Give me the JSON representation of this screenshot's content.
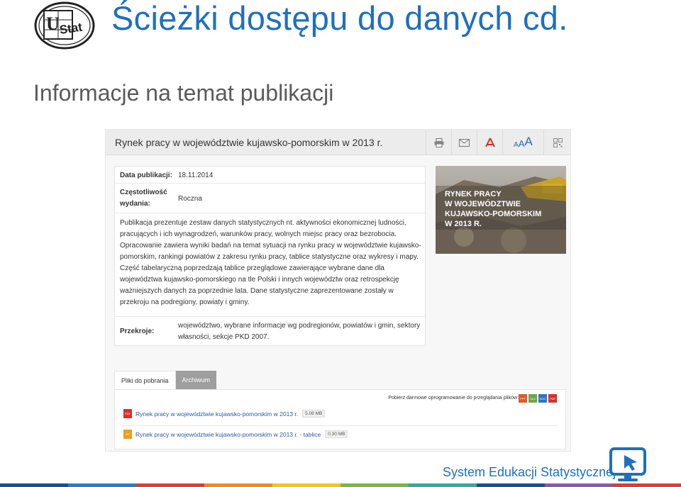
{
  "slide": {
    "title": "Ścieżki dostępu do danych cd.",
    "subtitle": "Informacje na temat publikacji",
    "footer": "System Edukacji Statystycznej",
    "logo_text": "UStat",
    "bar_colors": [
      "#1a4f8f",
      "#2e7bc4",
      "#e03a3a",
      "#f08a24",
      "#f4c518",
      "#7ab648",
      "#3aa6a0",
      "#1a4f8f",
      "#8a5aa8",
      "#e03a3a"
    ]
  },
  "publication": {
    "title": "Rynek pracy w województwie kujawsko-pomorskim w 2013 r.",
    "toolbar": {
      "print_icon": "printer-icon",
      "mail_icon": "envelope-icon",
      "pdf_icon": "pdf-icon",
      "font_small": "A",
      "font_medium": "A",
      "font_large": "A",
      "qr_icon": "qr-code-icon"
    },
    "meta": {
      "date_label": "Data publikacji:",
      "date_value": "18.11.2014",
      "frequency_label_1": "Częstotliwość",
      "frequency_label_2": "wydania:",
      "frequency_value": "Roczna",
      "description": "Publikacja prezentuje zestaw danych statystycznych nt. aktywności ekonomicznej ludności, pracujących i ich wynagrodzeń, warunków pracy, wolnych miejsc pracy oraz bezrobocia. Opracowanie zawiera wyniki badań na temat sytuacji na rynku pracy w województwie kujawsko-pomorskim, rankingi powiatów z zakresu rynku pracy, tablice statystyczne oraz wykresy i mapy. Część tabelaryczną poprzedzają tablice przeglądowe zawierające wybrane dane dla województwa kujawsko-pomorskiego na tle Polski i innych województw oraz retrospekcję ważniejszych danych za poprzednie lata. Dane statystyczne zaprezentowane zostały w przekroju na podregiony, powiaty i gminy.",
      "sections_label": "Przekroje:",
      "sections_value_1": "województwo, wybrane informacje wg podregionów, powiatów i gmin, sektory",
      "sections_value_2": "własności, sekcje PKD 2007."
    },
    "cover_text": "RYNEK PRACY\nW WOJEWÓDZTWIE\nKUJAWSKO-POMORSKIM\nW 2013 R.",
    "tabs": [
      {
        "label": "Pliki do pobrania"
      },
      {
        "label": "Archiwum"
      }
    ],
    "software_text": "Pobierz darmowe oprogramowanie do przeglądania plików:",
    "software_icons": [
      {
        "label": "PPT",
        "color": "#e2572a"
      },
      {
        "label": "XLS",
        "color": "#6aa84f"
      },
      {
        "label": "DOC",
        "color": "#2e75c4"
      },
      {
        "label": "PDF",
        "color": "#d9302b"
      }
    ],
    "files": [
      {
        "icon_label": "PDF",
        "icon_color": "#d9302b",
        "name": "Rynek pracy w województwie kujawsko-pomorskim w 2013 r.",
        "size": "5.08 MB"
      },
      {
        "icon_label": "ZIP",
        "icon_color": "#e8a020",
        "name": "Rynek pracy w województwie kujawsko-pomorskim w 2013 r. - tablice",
        "size": "0.30 MB"
      }
    ]
  }
}
